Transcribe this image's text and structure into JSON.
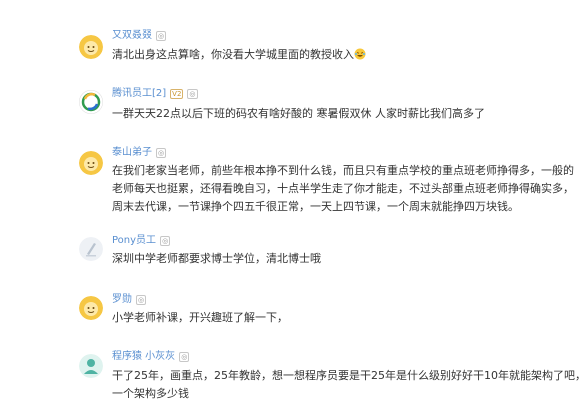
{
  "comments": [
    {
      "user": "又双叒叕",
      "badges": [
        "◎"
      ],
      "avatar": "yellow-face-avatar",
      "lines": [
        "清北出身这点算啥，你没看大学城里面的教授收入"
      ],
      "emoji": "laughing-tears-emoji"
    },
    {
      "user": "腾讯员工[2]",
      "badges": [
        "V2",
        "◎"
      ],
      "avatar": "green-circle-avatar",
      "lines": [
        "一群天天22点以后下班的码农有啥好酸的 寒暑假双休 人家时薪比我们高多了"
      ]
    },
    {
      "user": "泰山弟子",
      "badges": [
        "◎"
      ],
      "avatar": "yellow-face-avatar",
      "lines": [
        "在我们老家当老师，前些年根本挣不到什么钱，而且只有重点学校的重点班老师挣得多，一般的",
        "老师每天也挺累，还得看晚自习，十点半学生走了你才能走，不过头部重点班老师挣得确实多，",
        "周末去代课，一节课挣个四五千很正常，一天上四节课，一个周末就能挣四万块钱。"
      ]
    },
    {
      "user": "Pony员工",
      "badges": [
        "◎"
      ],
      "avatar": "gray-default-avatar",
      "lines": [
        "深圳中学老师都要求博士学位，清北博士哦"
      ]
    },
    {
      "user": "罗勋",
      "badges": [
        "◎"
      ],
      "avatar": "yellow-face-avatar",
      "lines": [
        "小学老师补课，开兴趣班了解一下，"
      ]
    },
    {
      "user": "程序猿 小灰灰",
      "badges": [
        "◎"
      ],
      "avatar": "teal-person-avatar",
      "lines": [
        "干了25年，画重点，25年教龄，想一想程序员要是干25年是什么级别好好干10年就能架构了吧，",
        "一个架构多少钱"
      ]
    }
  ],
  "colors": {
    "username": "#5a8fd0",
    "text": "#333333",
    "badge": "#999999"
  }
}
